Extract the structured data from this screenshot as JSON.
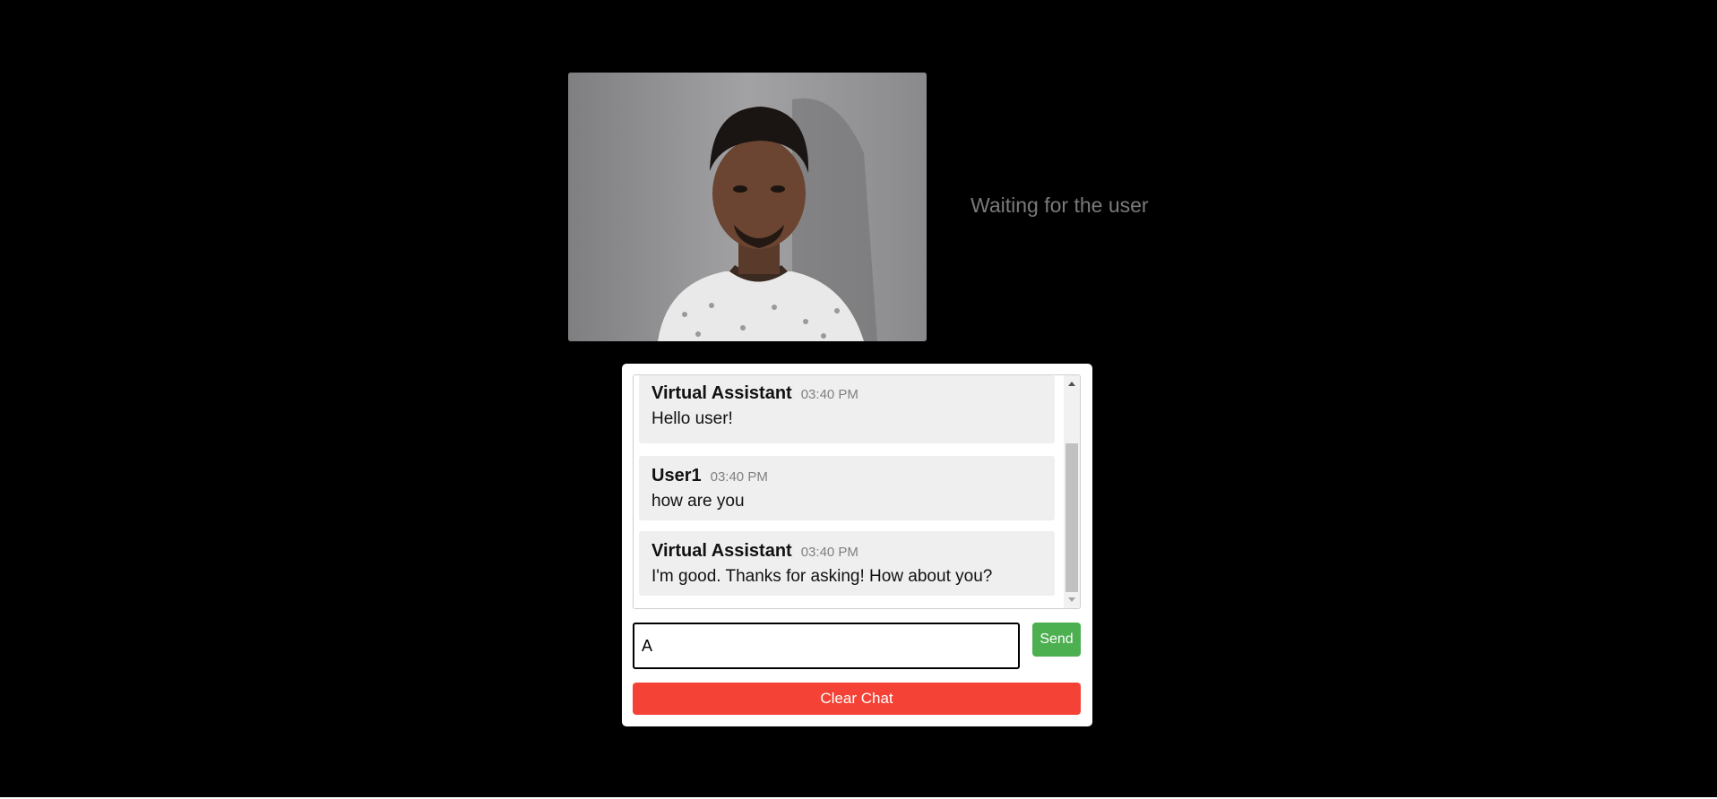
{
  "status": {
    "text": "Waiting for the user"
  },
  "chat": {
    "messages": [
      {
        "sender": "Virtual Assistant",
        "time": "03:40 PM",
        "text": "Hello user!"
      },
      {
        "sender": "User1",
        "time": "03:40 PM",
        "text": "how are you"
      },
      {
        "sender": "Virtual Assistant",
        "time": "03:40 PM",
        "text": "I'm good. Thanks for asking! How about you?"
      }
    ],
    "input_value": "A",
    "send_label": "Send",
    "clear_label": "Clear Chat"
  },
  "colors": {
    "send": "#4caf50",
    "clear": "#f44336",
    "background": "#000000"
  },
  "icons": {
    "scroll_up": "triangle-up",
    "scroll_down": "triangle-down"
  }
}
